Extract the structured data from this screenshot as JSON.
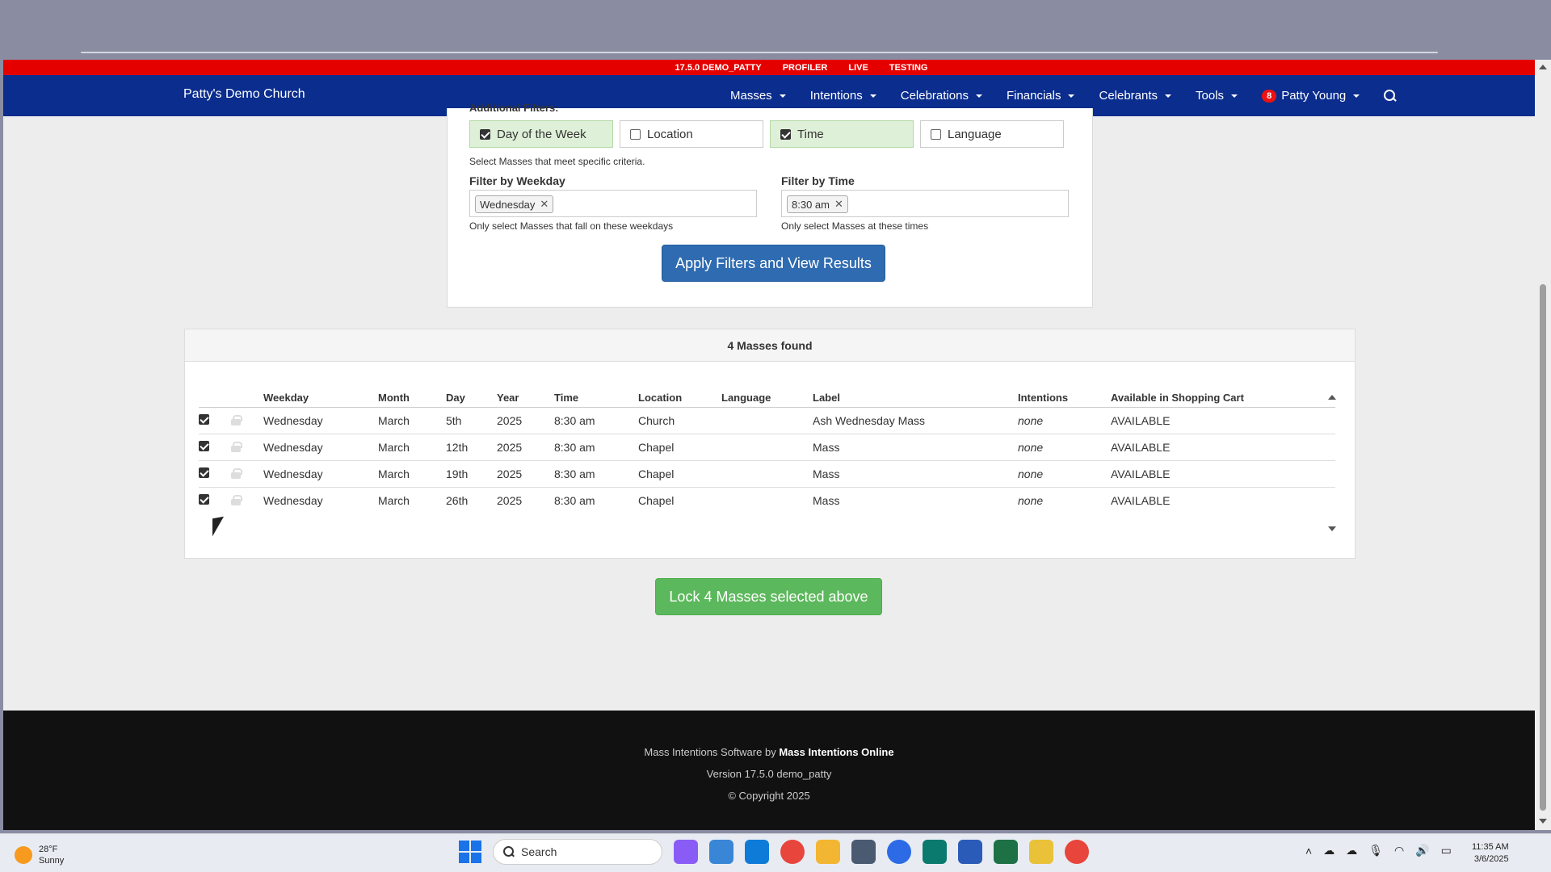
{
  "env_bar": [
    "17.5.0 DEMO_PATTY",
    "PROFILER",
    "LIVE",
    "TESTING"
  ],
  "brand": "Patty's Demo Church",
  "nav": [
    {
      "label": "Masses"
    },
    {
      "label": "Intentions"
    },
    {
      "label": "Celebrations"
    },
    {
      "label": "Financials"
    },
    {
      "label": "Celebrants"
    },
    {
      "label": "Tools"
    }
  ],
  "user": {
    "badge": "8",
    "name": "Patty Young"
  },
  "filters": {
    "heading": "Additional Filters:",
    "options": [
      {
        "label": "Day of the Week",
        "checked": true
      },
      {
        "label": "Location",
        "checked": false
      },
      {
        "label": "Time",
        "checked": true
      },
      {
        "label": "Language",
        "checked": false
      }
    ],
    "help": "Select Masses that meet specific criteria.",
    "weekday": {
      "label": "Filter by Weekday",
      "tag": "Wednesday",
      "help": "Only select Masses that fall on these weekdays"
    },
    "time": {
      "label": "Filter by Time",
      "tag": "8:30 am",
      "help": "Only select Masses at these times"
    },
    "apply_label": "Apply Filters and View Results"
  },
  "results": {
    "header": "4 Masses found",
    "columns": [
      "Weekday",
      "Month",
      "Day",
      "Year",
      "Time",
      "Location",
      "Language",
      "Label",
      "Intentions",
      "Available in Shopping Cart"
    ],
    "rows": [
      {
        "weekday": "Wednesday",
        "month": "March",
        "day": "5th",
        "year": "2025",
        "time": "8:30 am",
        "location": "Church",
        "language": "",
        "label": "Ash Wednesday Mass",
        "intentions": "none",
        "available": "AVAILABLE"
      },
      {
        "weekday": "Wednesday",
        "month": "March",
        "day": "12th",
        "year": "2025",
        "time": "8:30 am",
        "location": "Chapel",
        "language": "",
        "label": "Mass",
        "intentions": "none",
        "available": "AVAILABLE"
      },
      {
        "weekday": "Wednesday",
        "month": "March",
        "day": "19th",
        "year": "2025",
        "time": "8:30 am",
        "location": "Chapel",
        "language": "",
        "label": "Mass",
        "intentions": "none",
        "available": "AVAILABLE"
      },
      {
        "weekday": "Wednesday",
        "month": "March",
        "day": "26th",
        "year": "2025",
        "time": "8:30 am",
        "location": "Chapel",
        "language": "",
        "label": "Mass",
        "intentions": "none",
        "available": "AVAILABLE"
      }
    ]
  },
  "lock_label": "Lock 4 Masses selected above",
  "footer": {
    "line1_prefix": "Mass Intentions Software by ",
    "line1_brand": "Mass Intentions Online",
    "version": "Version 17.5.0 demo_patty",
    "copyright": "© Copyright 2025"
  },
  "taskbar": {
    "temp": "28°F",
    "condition": "Sunny",
    "search_placeholder": "Search",
    "time": "11:35 AM",
    "date": "3/6/2025"
  },
  "colors": {
    "env_bar": "#e50000",
    "navbar": "#0a2d8e",
    "apply": "#2f6bb0",
    "lock": "#5cb85c",
    "filter_on": "#dff0d8"
  }
}
